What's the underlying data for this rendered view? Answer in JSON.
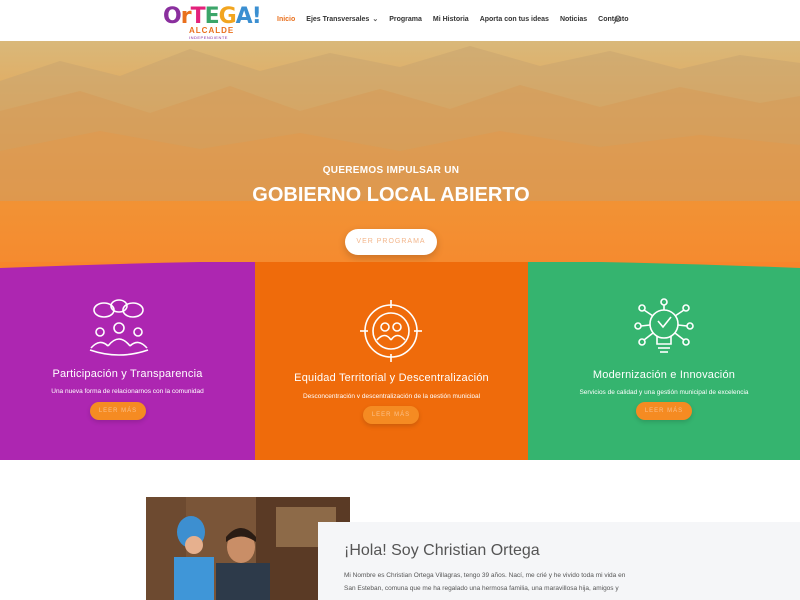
{
  "header": {
    "logo": {
      "letters": [
        "O",
        "r",
        "T",
        "E",
        "G",
        "A!"
      ],
      "sub": "ALCALDE",
      "sub2": "INDEPENDIENTE"
    },
    "nav": [
      {
        "label": "Inicio",
        "active": true
      },
      {
        "label": "Ejes Transversales",
        "has_dropdown": true
      },
      {
        "label": "Programa"
      },
      {
        "label": "Mi Historia"
      },
      {
        "label": "Aporta con tus ideas"
      },
      {
        "label": "Noticias"
      },
      {
        "label": "Contacto"
      }
    ],
    "dropdown_icon": "chevron-down-icon",
    "search_icon": "search-icon"
  },
  "hero": {
    "kicker": "QUEREMOS IMPULSAR UN",
    "title": "GOBIERNO LOCAL ABIERTO",
    "button": "VER PROGRAMA"
  },
  "features": [
    {
      "icon": "participation-group-icon",
      "title": "Participación y Transparencia",
      "text": "Una nueva forma de relacionarnos con la comunidad",
      "button": "LEER MÁS",
      "color": "#ad26b1"
    },
    {
      "icon": "target-people-icon",
      "title": "Equidad Territorial y Descentralización",
      "text": "Desconcentración y descentralización de la gestión municipal",
      "button": "LEER MÁS",
      "color": "#ef6b0b"
    },
    {
      "icon": "lightbulb-network-icon",
      "title": "Modernización e Innovación",
      "text": "Servicios de calidad y una gestión municipal de excelencia",
      "button": "LEER MÁS",
      "color": "#35b46f"
    }
  ],
  "about": {
    "title": "¡Hola! Soy Christian Ortega",
    "text_line1": "Mi Nombre es Christian Ortega Villagras, tengo 39 años. Nací, me crié y he vivido toda mi vida en",
    "text_line2": "San Esteban, comuna que me ha regalado una hermosa familia, una maravillosa hija, amigos y"
  },
  "colors": {
    "accent": "#e9701d",
    "purple": "#ad26b1",
    "orange": "#ef6b0b",
    "green": "#35b46f"
  }
}
